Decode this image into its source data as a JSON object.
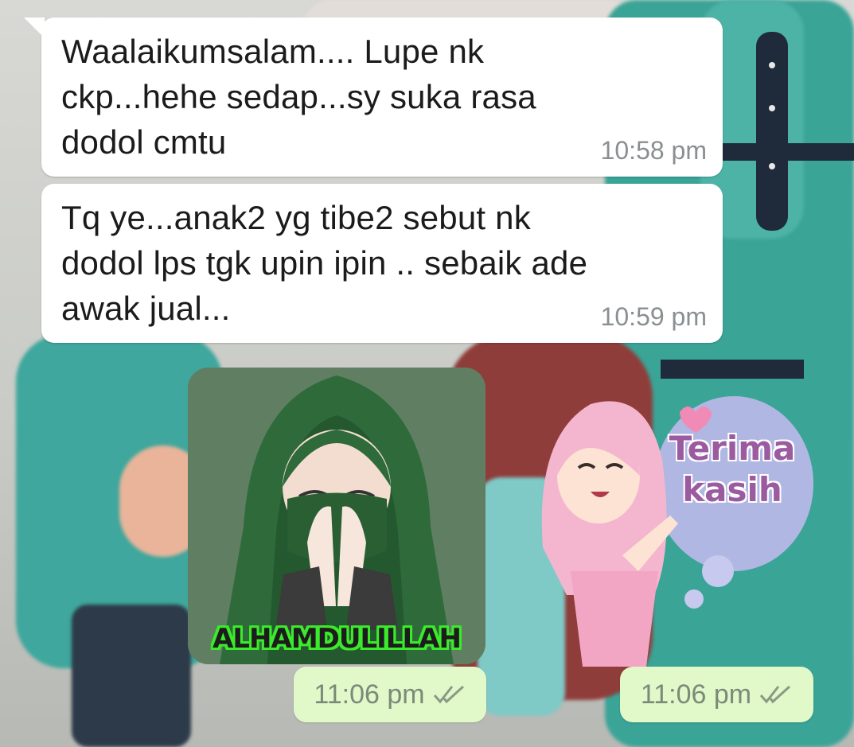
{
  "messages": [
    {
      "direction": "incoming",
      "text": "Waalaikumsalam.... Lupe nk ckp...hehe sedap...sy suka rasa dodol cmtu",
      "time": "10:58 pm"
    },
    {
      "direction": "incoming",
      "text": "Tq ye...anak2 yg tibe2 sebut nk dodol lps tgk upin ipin .. sebaik ade awak jual...",
      "time": "10:59 pm"
    }
  ],
  "stickers": [
    {
      "caption": "ALHAMDULILLAH",
      "time": "11:06 pm",
      "status_icon": "double-check-icon"
    },
    {
      "caption_line1": "Terima",
      "caption_line2": "kasih",
      "time": "11:06 pm",
      "status_icon": "double-check-icon"
    }
  ],
  "colors": {
    "incoming_bubble": "#ffffff",
    "outgoing_bubble": "#e1f8c9",
    "timestamp": "#8a8f92",
    "sticker_caption_outline": "#3bea2b"
  }
}
